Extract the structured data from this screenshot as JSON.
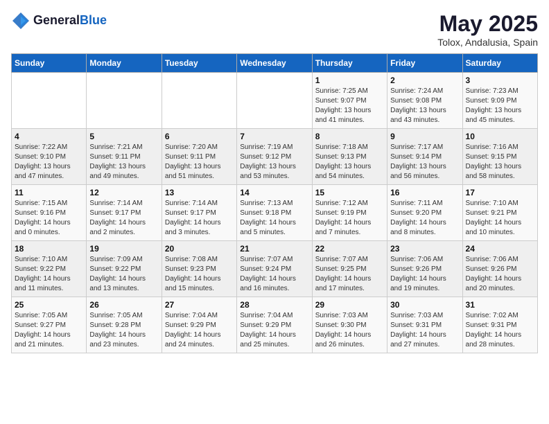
{
  "header": {
    "logo_line1": "General",
    "logo_line2": "Blue",
    "title": "May 2025",
    "subtitle": "Tolox, Andalusia, Spain"
  },
  "weekdays": [
    "Sunday",
    "Monday",
    "Tuesday",
    "Wednesday",
    "Thursday",
    "Friday",
    "Saturday"
  ],
  "weeks": [
    [
      {
        "day": "",
        "detail": ""
      },
      {
        "day": "",
        "detail": ""
      },
      {
        "day": "",
        "detail": ""
      },
      {
        "day": "",
        "detail": ""
      },
      {
        "day": "1",
        "detail": "Sunrise: 7:25 AM\nSunset: 9:07 PM\nDaylight: 13 hours\nand 41 minutes."
      },
      {
        "day": "2",
        "detail": "Sunrise: 7:24 AM\nSunset: 9:08 PM\nDaylight: 13 hours\nand 43 minutes."
      },
      {
        "day": "3",
        "detail": "Sunrise: 7:23 AM\nSunset: 9:09 PM\nDaylight: 13 hours\nand 45 minutes."
      }
    ],
    [
      {
        "day": "4",
        "detail": "Sunrise: 7:22 AM\nSunset: 9:10 PM\nDaylight: 13 hours\nand 47 minutes."
      },
      {
        "day": "5",
        "detail": "Sunrise: 7:21 AM\nSunset: 9:11 PM\nDaylight: 13 hours\nand 49 minutes."
      },
      {
        "day": "6",
        "detail": "Sunrise: 7:20 AM\nSunset: 9:11 PM\nDaylight: 13 hours\nand 51 minutes."
      },
      {
        "day": "7",
        "detail": "Sunrise: 7:19 AM\nSunset: 9:12 PM\nDaylight: 13 hours\nand 53 minutes."
      },
      {
        "day": "8",
        "detail": "Sunrise: 7:18 AM\nSunset: 9:13 PM\nDaylight: 13 hours\nand 54 minutes."
      },
      {
        "day": "9",
        "detail": "Sunrise: 7:17 AM\nSunset: 9:14 PM\nDaylight: 13 hours\nand 56 minutes."
      },
      {
        "day": "10",
        "detail": "Sunrise: 7:16 AM\nSunset: 9:15 PM\nDaylight: 13 hours\nand 58 minutes."
      }
    ],
    [
      {
        "day": "11",
        "detail": "Sunrise: 7:15 AM\nSunset: 9:16 PM\nDaylight: 14 hours\nand 0 minutes."
      },
      {
        "day": "12",
        "detail": "Sunrise: 7:14 AM\nSunset: 9:17 PM\nDaylight: 14 hours\nand 2 minutes."
      },
      {
        "day": "13",
        "detail": "Sunrise: 7:14 AM\nSunset: 9:17 PM\nDaylight: 14 hours\nand 3 minutes."
      },
      {
        "day": "14",
        "detail": "Sunrise: 7:13 AM\nSunset: 9:18 PM\nDaylight: 14 hours\nand 5 minutes."
      },
      {
        "day": "15",
        "detail": "Sunrise: 7:12 AM\nSunset: 9:19 PM\nDaylight: 14 hours\nand 7 minutes."
      },
      {
        "day": "16",
        "detail": "Sunrise: 7:11 AM\nSunset: 9:20 PM\nDaylight: 14 hours\nand 8 minutes."
      },
      {
        "day": "17",
        "detail": "Sunrise: 7:10 AM\nSunset: 9:21 PM\nDaylight: 14 hours\nand 10 minutes."
      }
    ],
    [
      {
        "day": "18",
        "detail": "Sunrise: 7:10 AM\nSunset: 9:22 PM\nDaylight: 14 hours\nand 11 minutes."
      },
      {
        "day": "19",
        "detail": "Sunrise: 7:09 AM\nSunset: 9:22 PM\nDaylight: 14 hours\nand 13 minutes."
      },
      {
        "day": "20",
        "detail": "Sunrise: 7:08 AM\nSunset: 9:23 PM\nDaylight: 14 hours\nand 15 minutes."
      },
      {
        "day": "21",
        "detail": "Sunrise: 7:07 AM\nSunset: 9:24 PM\nDaylight: 14 hours\nand 16 minutes."
      },
      {
        "day": "22",
        "detail": "Sunrise: 7:07 AM\nSunset: 9:25 PM\nDaylight: 14 hours\nand 17 minutes."
      },
      {
        "day": "23",
        "detail": "Sunrise: 7:06 AM\nSunset: 9:26 PM\nDaylight: 14 hours\nand 19 minutes."
      },
      {
        "day": "24",
        "detail": "Sunrise: 7:06 AM\nSunset: 9:26 PM\nDaylight: 14 hours\nand 20 minutes."
      }
    ],
    [
      {
        "day": "25",
        "detail": "Sunrise: 7:05 AM\nSunset: 9:27 PM\nDaylight: 14 hours\nand 21 minutes."
      },
      {
        "day": "26",
        "detail": "Sunrise: 7:05 AM\nSunset: 9:28 PM\nDaylight: 14 hours\nand 23 minutes."
      },
      {
        "day": "27",
        "detail": "Sunrise: 7:04 AM\nSunset: 9:29 PM\nDaylight: 14 hours\nand 24 minutes."
      },
      {
        "day": "28",
        "detail": "Sunrise: 7:04 AM\nSunset: 9:29 PM\nDaylight: 14 hours\nand 25 minutes."
      },
      {
        "day": "29",
        "detail": "Sunrise: 7:03 AM\nSunset: 9:30 PM\nDaylight: 14 hours\nand 26 minutes."
      },
      {
        "day": "30",
        "detail": "Sunrise: 7:03 AM\nSunset: 9:31 PM\nDaylight: 14 hours\nand 27 minutes."
      },
      {
        "day": "31",
        "detail": "Sunrise: 7:02 AM\nSunset: 9:31 PM\nDaylight: 14 hours\nand 28 minutes."
      }
    ]
  ]
}
